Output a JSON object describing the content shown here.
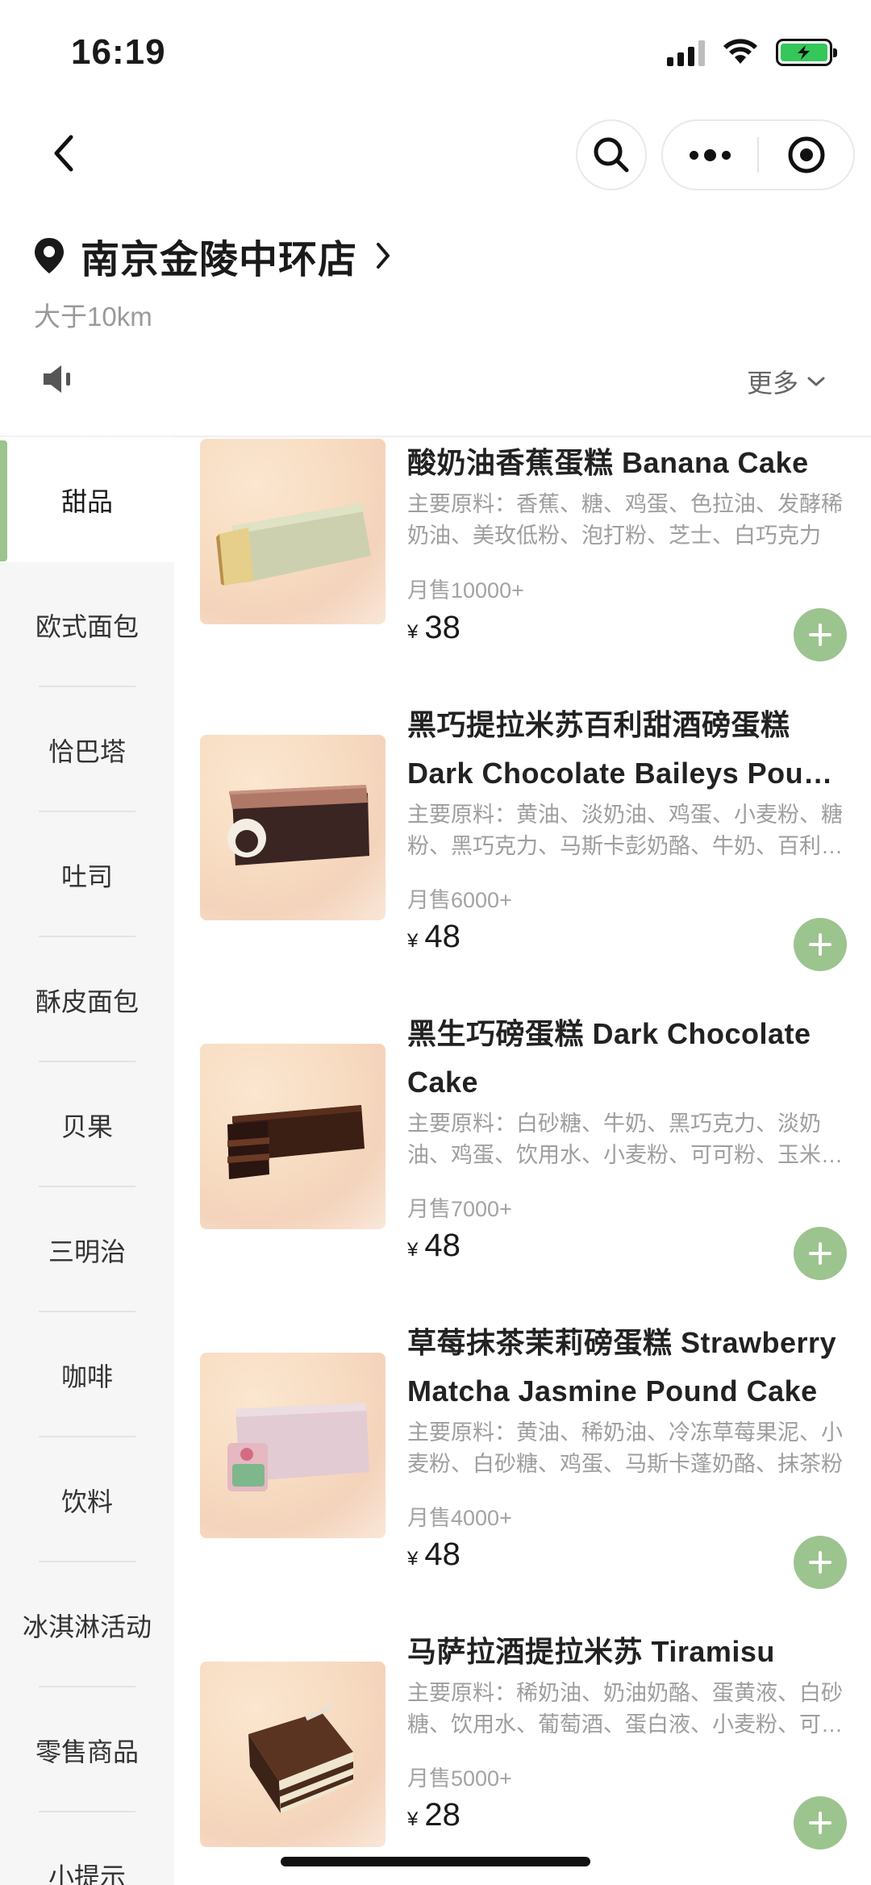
{
  "status_bar": {
    "time": "16:19"
  },
  "store": {
    "name": "南京金陵中环店",
    "distance": "大于10km",
    "more_label": "更多"
  },
  "categories": [
    {
      "label": "甜品",
      "active": true
    },
    {
      "label": "欧式面包"
    },
    {
      "label": "恰巴塔"
    },
    {
      "label": "吐司"
    },
    {
      "label": "酥皮面包"
    },
    {
      "label": "贝果"
    },
    {
      "label": "三明治"
    },
    {
      "label": "咖啡"
    },
    {
      "label": "饮料"
    },
    {
      "label": "冰淇淋活动"
    },
    {
      "label": "零售商品"
    },
    {
      "label": "小提示"
    }
  ],
  "products": [
    {
      "name": "酸奶油香蕉蛋糕 Banana Cake",
      "desc": "主要原料：香蕉、糖、鸡蛋、色拉油、发酵稀奶油、美玫低粉、泡打粉、芝士、白巧克力",
      "sales": "月售10000+",
      "currency": "¥",
      "price": "38"
    },
    {
      "name": "黑巧提拉米苏百利甜酒磅蛋糕 Dark Chocolate Baileys Pound Cake",
      "desc": "主要原料：黄油、淡奶油、鸡蛋、小麦粉、糖粉、黑巧克力、马斯卡彭奶酪、牛奶、百利甜酒",
      "sales": "月售6000+",
      "currency": "¥",
      "price": "48"
    },
    {
      "name": "黑生巧磅蛋糕 Dark Chocolate Cake",
      "desc": "主要原料：白砂糖、牛奶、黑巧克力、淡奶油、鸡蛋、饮用水、小麦粉、可可粉、玉米淀粉",
      "sales": "月售7000+",
      "currency": "¥",
      "price": "48"
    },
    {
      "name": "草莓抹茶茉莉磅蛋糕 Strawberry Matcha Jasmine Pound Cake",
      "desc": "主要原料：黄油、稀奶油、冷冻草莓果泥、小麦粉、白砂糖、鸡蛋、马斯卡蓬奶酪、抹茶粉",
      "sales": "月售4000+",
      "currency": "¥",
      "price": "48"
    },
    {
      "name": "马萨拉酒提拉米苏 Tiramisu",
      "desc": "主要原料：稀奶油、奶油奶酪、蛋黄液、白砂糖、饮用水、葡萄酒、蛋白液、小麦粉、可可粉",
      "sales": "月售5000+",
      "currency": "¥",
      "price": "28"
    }
  ]
}
